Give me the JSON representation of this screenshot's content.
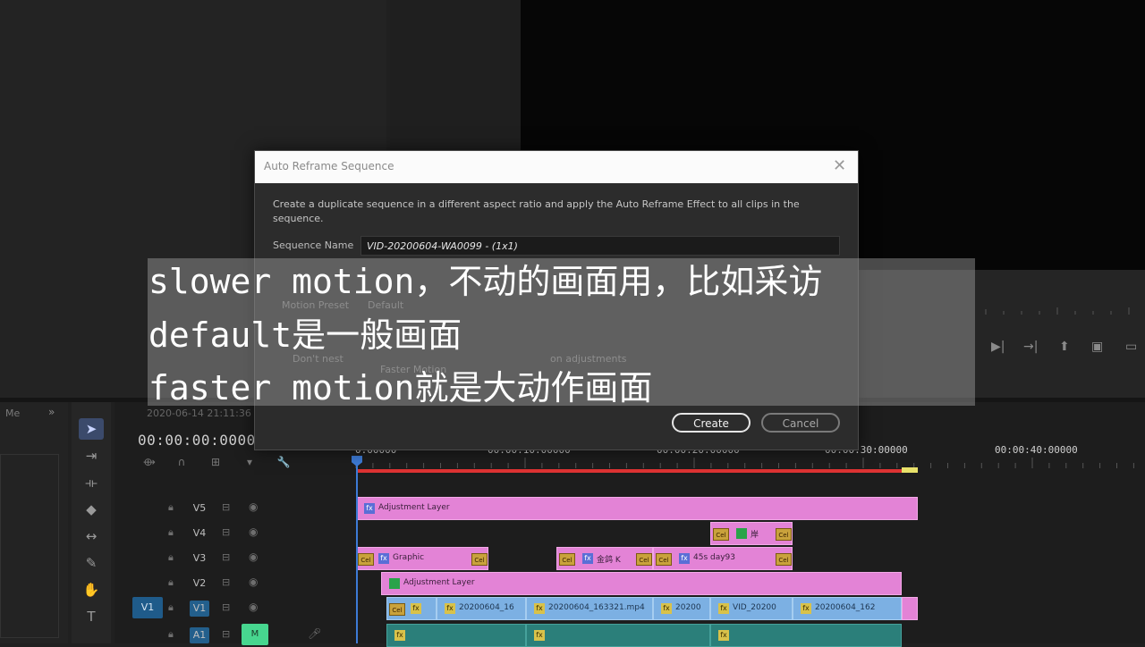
{
  "dialog": {
    "title": "Auto Reframe Sequence",
    "close": "✕",
    "description": "Create a duplicate sequence in a different aspect ratio and apply the Auto Reframe Effect to all clips in the sequence.",
    "sequence_name_label": "Sequence Name",
    "sequence_name_value": "VID-20200604-WA0099 - (1x1)",
    "create_label": "Create",
    "cancel_label": "Cancel",
    "motion_preset_label": "Motion Preset",
    "motion_preset_value": "Default",
    "dont_nest_label": "Don't nest",
    "faster_motion_label": "Faster Motion",
    "adjustments_label": "on adjustments"
  },
  "subtitles": {
    "line1": "slower motion，不动的画面用，比如采访",
    "line2": "default是一般画面",
    "line3": "faster motion就是大动作画面"
  },
  "project_panel": {
    "tab": "Me",
    "arrow": "»"
  },
  "timeline": {
    "sequence_date": "2020-06-14 21:11:36",
    "timecode": "00:00:00:00000",
    "ruler": [
      "0:00000",
      "00:00:10:00000",
      "00:00:20:00000",
      "00:00:30:00000",
      "00:00:40:00000"
    ],
    "tracks": [
      {
        "name": "V5"
      },
      {
        "name": "V4"
      },
      {
        "name": "V3"
      },
      {
        "name": "V2"
      },
      {
        "name": "V1",
        "source": "V1"
      },
      {
        "name": "A1",
        "mute": "M"
      }
    ],
    "clips": {
      "adjustment_v5": "Adjustment Layer",
      "graphic_v3": "Graphic",
      "text_v3": "金鸽 K",
      "text_v3b": "45s day93",
      "adjustment_v2": "Adjustment Layer",
      "v1_a": "20200604_16",
      "v1_b": "20200604_163321.mp4",
      "v1_c": "20200",
      "v1_d": "VID_20200",
      "v1_e": "20200604_162",
      "v4_label": "岸"
    }
  },
  "colors": {
    "adjustment_clip": "#e383d6",
    "video_clip": "#7cb0e3",
    "work_area": "#dd3333",
    "playhead": "#3d7bd6",
    "mute_button": "#47d68f"
  }
}
